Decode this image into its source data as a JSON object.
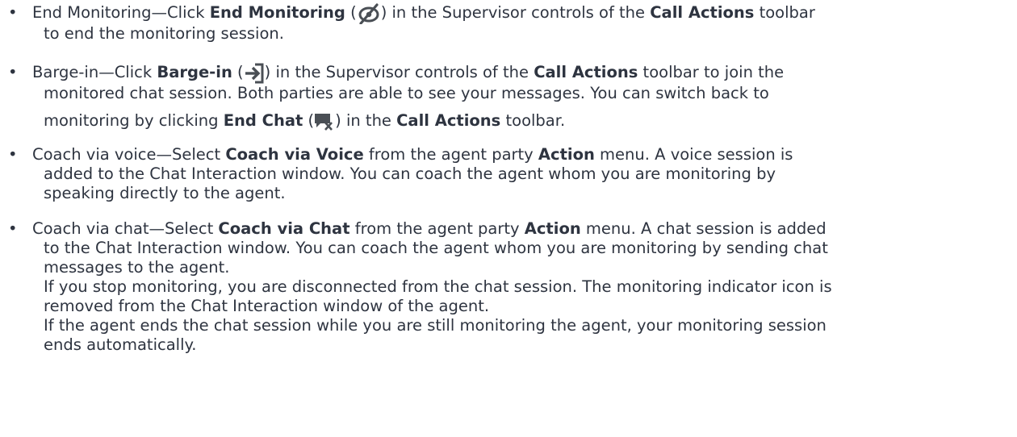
{
  "items": [
    {
      "l1a": "End Monitoring—Click ",
      "b1": "End Monitoring",
      "l1b": " (",
      "l1c": ") in the Supervisor controls of the ",
      "b2": "Call Actions",
      "l1d": " toolbar",
      "l2": "to end the monitoring session.",
      "icon": "eye-slash-icon"
    },
    {
      "l1a": "Barge-in—Click ",
      "b1": "Barge-in",
      "l1b": " (",
      "l1c": ") in the Supervisor controls of the ",
      "b2": "Call Actions",
      "l1d": " toolbar to join the",
      "l2": "monitored chat session. Both parties are able to see your messages. You can switch back to",
      "l3a": "monitoring by clicking ",
      "b3": "End Chat",
      "l3b": " (",
      "l3c": ") in the ",
      "b4": "Call Actions",
      "l3d": " toolbar.",
      "icon1": "sign-in-icon",
      "icon2": "end-chat-icon"
    },
    {
      "l1a": "Coach via voice—Select ",
      "b1": "Coach via Voice",
      "l1b": " from the agent party ",
      "b2": "Action",
      "l1c": " menu. A voice session is",
      "l2": "added to the Chat Interaction window. You can coach the agent whom you are monitoring by",
      "l3": "speaking directly to the agent."
    },
    {
      "l1a": "Coach via chat—Select ",
      "b1": "Coach via Chat",
      "l1b": " from the agent party ",
      "b2": "Action",
      "l1c": " menu. A chat session is added",
      "l2": "to the Chat Interaction window. You can coach the agent whom you are monitoring by sending chat",
      "l3": "messages to the agent.",
      "l4": "If you stop monitoring, you are disconnected from the chat session. The monitoring indicator icon is",
      "l5": "removed from the Chat Interaction window of the agent.",
      "l6": "If the agent ends the chat session while you are still monitoring the agent, your monitoring session",
      "l7": "ends automatically."
    }
  ],
  "colors": {
    "text": "#2e3440",
    "icon": "#4a4f55"
  }
}
